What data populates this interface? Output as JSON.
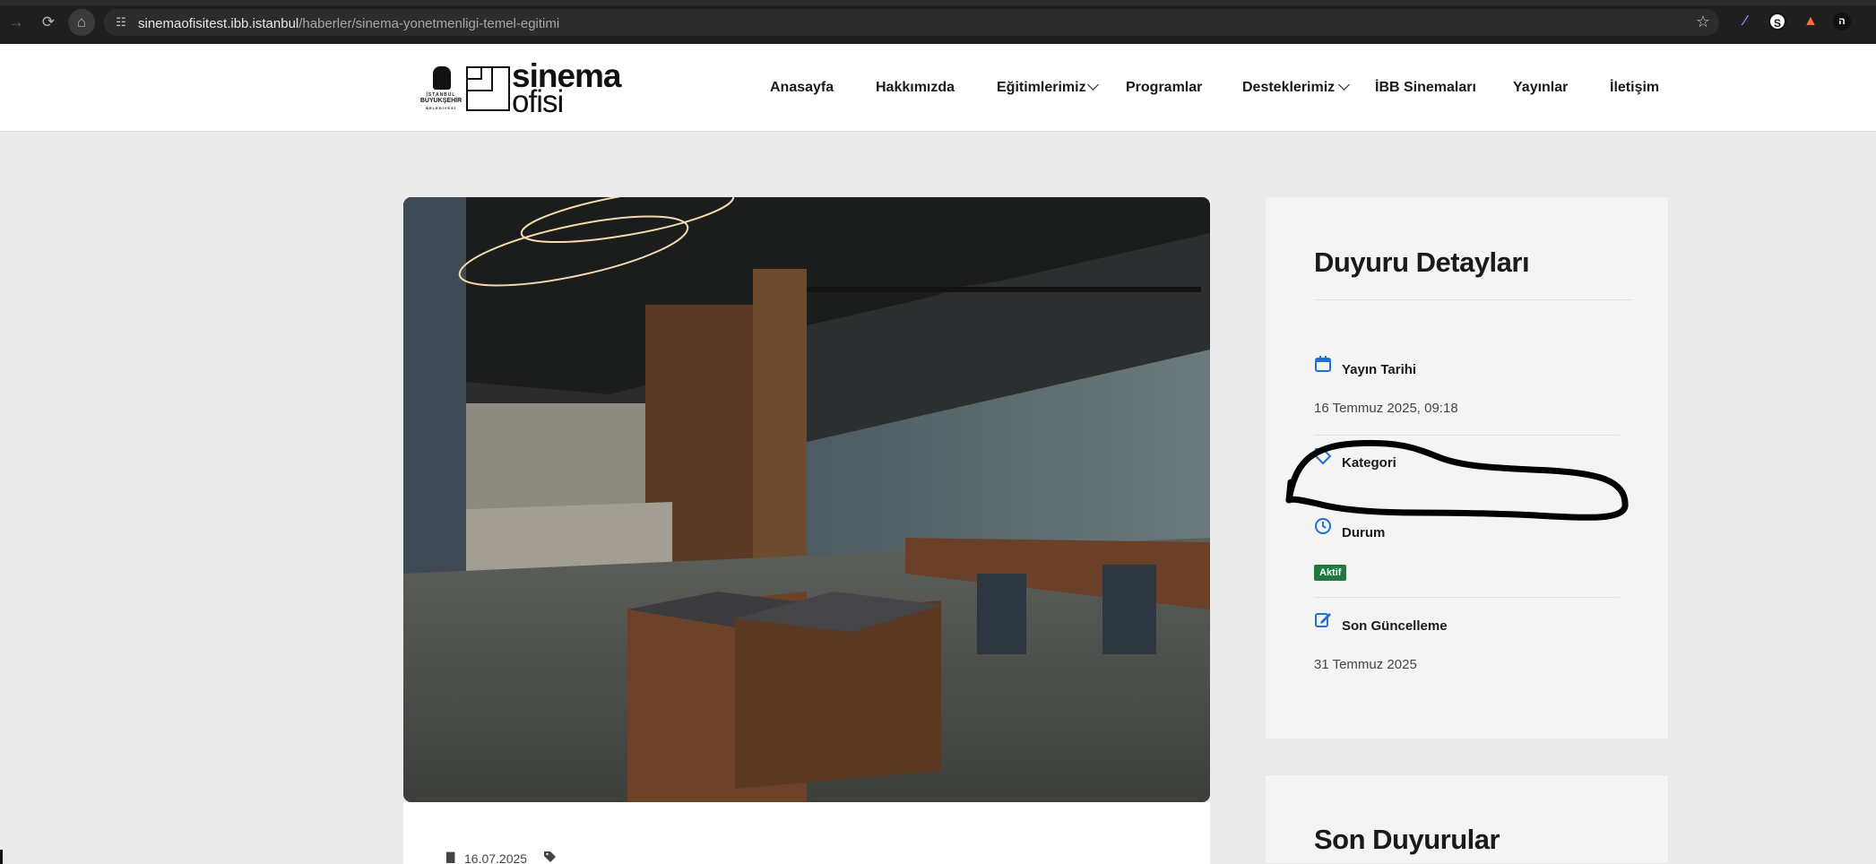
{
  "browser": {
    "url_host": "sinemaofisitest.ibb.istanbul",
    "url_path": "/haberler/sinema-yonetmenligi-temel-egitimi",
    "icons": [
      "back-arrow-icon",
      "reload-icon",
      "home-icon",
      "site-info-icon",
      "bookmark-star-icon"
    ],
    "extensions": [
      "feather-extension-icon",
      "s-extension-icon",
      "flame-extension-icon",
      "n-extension-icon"
    ],
    "ext_labels": [
      "⁄",
      "S",
      "▲",
      "ה"
    ]
  },
  "logo": {
    "emblem_line1": "İSTANBUL",
    "emblem_line2": "BÜYÜKŞEHİR",
    "emblem_line3": "BELEDİYESİ",
    "word1": "sinema",
    "word2": "ofisi"
  },
  "nav": {
    "items": [
      {
        "label": "Anasayfa",
        "has_dropdown": false
      },
      {
        "label": "Hakkımızda",
        "has_dropdown": false
      },
      {
        "label": "Eğitimlerimiz",
        "has_dropdown": true
      },
      {
        "label": "Programlar",
        "has_dropdown": false
      },
      {
        "label": "Desteklerimiz",
        "has_dropdown": true
      },
      {
        "label": "İBB Sinemaları",
        "has_dropdown": false
      },
      {
        "label": "Yayınlar",
        "has_dropdown": false
      },
      {
        "label": "İletişim",
        "has_dropdown": false
      }
    ]
  },
  "article": {
    "image_icon": "interior-photo",
    "date": "16.07.2025",
    "date_icon": "calendar-icon",
    "tag_icon": "tag-icon"
  },
  "sidebar": {
    "title": "Duyuru Detayları",
    "details": [
      {
        "icon": "calendar-icon",
        "label": "Yayın Tarihi",
        "value": "16 Temmuz 2025, 09:18"
      },
      {
        "icon": "tag-icon",
        "label": "Kategori",
        "value": ""
      },
      {
        "icon": "clock-icon",
        "label": "Durum",
        "badge": "Aktif"
      },
      {
        "icon": "edit-icon",
        "label": "Son Güncelleme",
        "value": "31 Temmuz 2025"
      }
    ],
    "accent_color": "#1f6fd6",
    "badge_color": "#1e7a3f",
    "recent_title": "Son Duyurular"
  }
}
